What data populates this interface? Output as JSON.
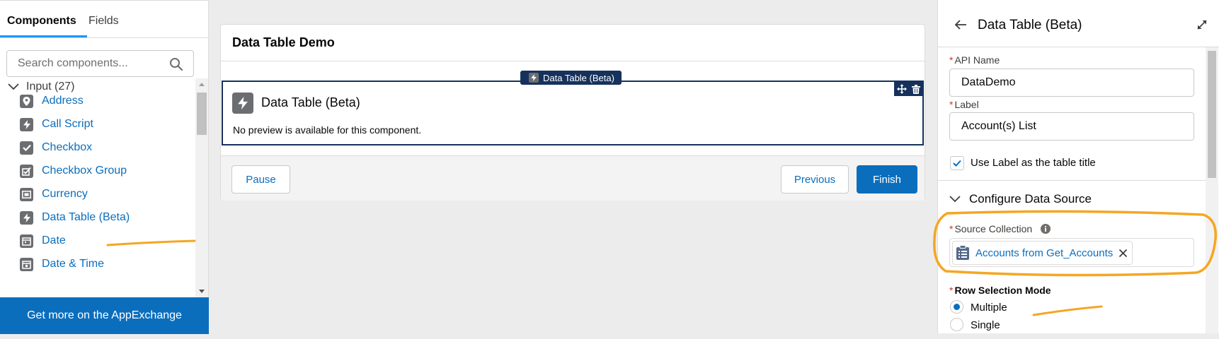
{
  "palette": {
    "tabs": [
      {
        "label": "Components",
        "active": true
      },
      {
        "label": "Fields",
        "active": false
      }
    ],
    "search_placeholder": "Search components...",
    "group": {
      "label": "Input (27)"
    },
    "items": [
      {
        "label": "Address",
        "icon": "location-pin-icon"
      },
      {
        "label": "Call Script",
        "icon": "lightning-icon"
      },
      {
        "label": "Checkbox",
        "icon": "checkbox-icon"
      },
      {
        "label": "Checkbox Group",
        "icon": "checkbox-group-icon"
      },
      {
        "label": "Currency",
        "icon": "currency-icon"
      },
      {
        "label": "Data Table (Beta)",
        "icon": "lightning-icon"
      },
      {
        "label": "Date",
        "icon": "calendar-icon"
      },
      {
        "label": "Date & Time",
        "icon": "calendar-clock-icon"
      }
    ],
    "appexchange": "Get more on the AppExchange"
  },
  "canvas": {
    "screen_title": "Data Table Demo",
    "component_tag": "Data Table (Beta)",
    "component_title": "Data Table (Beta)",
    "preview_note": "No preview is available for this component.",
    "buttons": {
      "pause": "Pause",
      "previous": "Previous",
      "finish": "Finish"
    }
  },
  "properties": {
    "title": "Data Table (Beta)",
    "api_name_label": "API Name",
    "api_name_value": "DataDemo",
    "label_label": "Label",
    "label_value": "Account(s) List",
    "use_label_title": "Use Label as the table title",
    "use_label_checked": true,
    "section": "Configure Data Source",
    "source_collection_label": "Source Collection",
    "source_collection_value": "Accounts from Get_Accounts",
    "row_selection_label": "Row Selection Mode",
    "row_selection_options": [
      {
        "label": "Multiple",
        "selected": true
      },
      {
        "label": "Single",
        "selected": false
      }
    ]
  },
  "colors": {
    "brand": "#0b6ebd",
    "selected_component": "#16325c",
    "annotation": "#f5a623",
    "required": "#c23934"
  }
}
